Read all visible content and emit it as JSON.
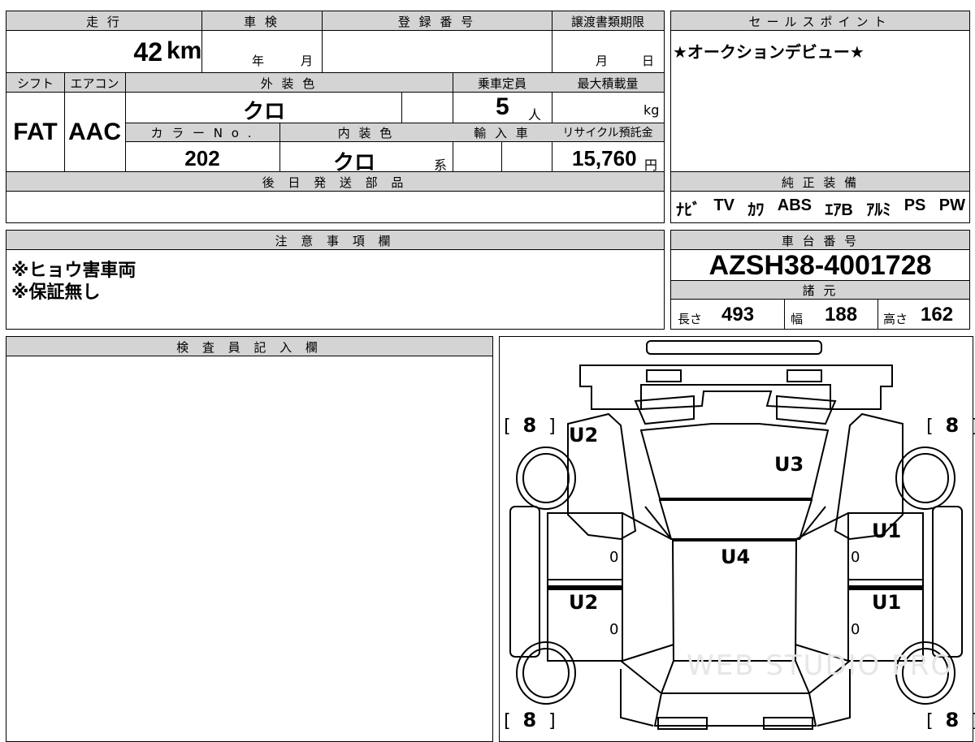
{
  "top": {
    "mileage_label": "走 行",
    "mileage_value": "42",
    "mileage_unit": "km",
    "inspection_label": "車 検",
    "inspection_year": "年",
    "inspection_month": "月",
    "reg_label": "登 録 番 号",
    "transfer_label": "譲渡書類期限",
    "transfer_month": "月",
    "transfer_day": "日",
    "shift_label": "シフト",
    "shift_value": "FAT",
    "ac_label": "エアコン",
    "ac_value": "AAC",
    "exterior_label": "外 装 色",
    "exterior_value": "クロ",
    "capacity_label": "乗車定員",
    "capacity_value": "5",
    "capacity_unit": "人",
    "maxload_label": "最大積載量",
    "maxload_unit": "kg",
    "colorno_label": "カ ラ ー N o .",
    "colorno_value": "202",
    "interior_label": "内 装 色",
    "interior_value": "クロ",
    "interior_suffix": "系",
    "import_label": "輸 入 車",
    "recycle_label": "リサイクル預託金",
    "recycle_value": "15,760",
    "recycle_unit": "円",
    "later_parts_label": "後 日 発 送 部 品"
  },
  "sales": {
    "label": "セールスポイント",
    "text": "★オークションデビュー★"
  },
  "equipment": {
    "label": "純 正 装 備",
    "items": [
      "ﾅﾋﾞ",
      "TV",
      "ｶﾜ",
      "ABS",
      "ｴｱB",
      "ｱﾙﾐ",
      "PS",
      "PW"
    ]
  },
  "notes": {
    "label": "注 意 事 項 欄",
    "line1": "※ヒョウ害車両",
    "line2": "※保証無し"
  },
  "chassis": {
    "label": "車 台 番 号",
    "value": "AZSH38-4001728",
    "spec_label": "諸 元",
    "length_label": "長さ",
    "length_value": "493",
    "width_label": "幅",
    "width_value": "188",
    "height_label": "高さ",
    "height_value": "162"
  },
  "inspector": {
    "label": "検 査 員 記 入 欄"
  },
  "diagram": {
    "tire_tl": "8",
    "tire_tr": "8",
    "tire_bl": "8",
    "tire_br": "8",
    "mark_front_left": "U2",
    "mark_bonnet": "U3",
    "mark_right_front_door": "U1",
    "mark_roof": "U4",
    "mark_left_rear_door": "U2",
    "mark_right_rear_door": "U1",
    "zero_lf": "0",
    "zero_lr": "0",
    "zero_rf": "0",
    "zero_rr": "0",
    "watermark": "WEB STUDIO PRO"
  }
}
